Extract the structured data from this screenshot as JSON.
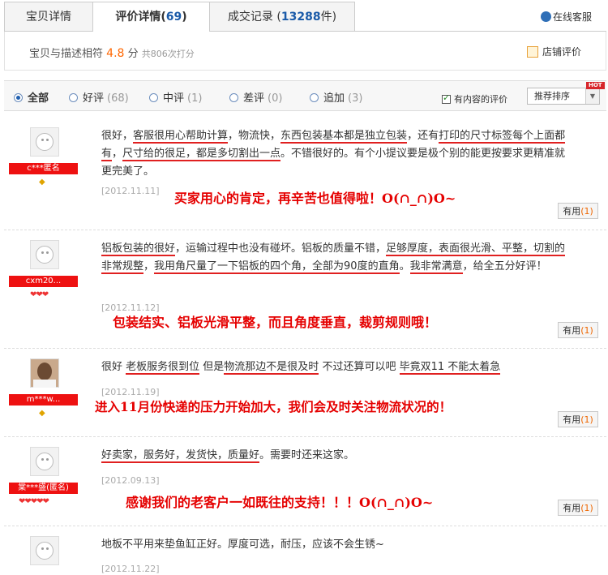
{
  "tabs": [
    {
      "label": "宝贝详情",
      "count": ""
    },
    {
      "label": "评价详情(",
      "count": "69",
      "suffix": ")"
    },
    {
      "label": "成交记录 (",
      "count": "13288",
      "suffix": "件)"
    }
  ],
  "online_service": "在线客服",
  "summary": {
    "label": "宝贝与描述相符",
    "score": "4.8",
    "unit": "分",
    "count_text": "共806次打分",
    "shop_rating": "店铺评价"
  },
  "filters": [
    {
      "label": "全部",
      "count": ""
    },
    {
      "label": "好评",
      "count": "(68)"
    },
    {
      "label": "中评",
      "count": "(1)"
    },
    {
      "label": "差评",
      "count": "(0)"
    },
    {
      "label": "追加",
      "count": "(3)"
    }
  ],
  "content_only_label": "有内容的评价",
  "sort": {
    "selected": "推荐排序",
    "hot": "HOT"
  },
  "reviews": [
    {
      "user": "c***匿名",
      "badge": "◆",
      "segments": [
        {
          "t": "很好，",
          "u": false
        },
        {
          "t": "客服很用心帮助计算",
          "u": true
        },
        {
          "t": "，物流快，",
          "u": false
        },
        {
          "t": "东西包装基本都是独立包装",
          "u": true
        },
        {
          "t": "，还有",
          "u": false
        },
        {
          "t": "打印的尺寸标签每个上面都有",
          "u": true
        },
        {
          "t": "，",
          "u": false
        },
        {
          "t": "尺寸给的很足，都是多切割出一点",
          "u": true
        },
        {
          "t": "。不错很好的。有个小提议要是极个别的能更按要求更精准就更完美了。",
          "u": false
        }
      ],
      "date": "[2012.11.11]",
      "annotation": "买家用心的肯定，再辛苦也值得啦！O(∩_∩)O~",
      "useful_label": "有用",
      "useful_count": "(1)"
    },
    {
      "user": "cxm20...",
      "badge": "❤❤❤",
      "segments": [
        {
          "t": "铝板包装的很好",
          "u": true
        },
        {
          "t": "，运输过程中也没有碰坏。铝板的质量不错，",
          "u": false
        },
        {
          "t": "足够厚度，表面很光滑、平整，切割的非常规整",
          "u": true
        },
        {
          "t": "，",
          "u": false
        },
        {
          "t": "我用角尺量了一下铝板的四个角，全部为90度的直角",
          "u": true
        },
        {
          "t": "。",
          "u": false
        },
        {
          "t": "我非常满意",
          "u": true
        },
        {
          "t": "，给全五分好评！",
          "u": false
        }
      ],
      "date": "[2012.11.12]",
      "annotation": "包装结实、铝板光滑平整，而且角度垂直，裁剪规则哦！",
      "useful_label": "有用",
      "useful_count": "(1)"
    },
    {
      "user": "m***w...",
      "badge": "◆",
      "segments": [
        {
          "t": "很好 ",
          "u": false
        },
        {
          "t": "老板服务很到位",
          "u": true
        },
        {
          "t": " 但是",
          "u": false
        },
        {
          "t": "物流那边不是很及时",
          "u": true
        },
        {
          "t": " 不过还算可以吧 ",
          "u": false
        },
        {
          "t": "毕竟双11 不能太着急",
          "u": true
        }
      ],
      "date": "[2012.11.19]",
      "annotation": "进入11月份快递的压力开始加大，我们会及时关注物流状况的！",
      "useful_label": "有用",
      "useful_count": "(1)"
    },
    {
      "user": "棠***盛(匿名)",
      "badge": "❤❤❤❤❤",
      "segments": [
        {
          "t": "好卖家，服务好，发货快，质量好",
          "u": true
        },
        {
          "t": "。需要时还来这家。",
          "u": false
        }
      ],
      "date": "[2012.09.13]",
      "annotation": "感谢我们的老客户一如既往的支持！！！O(∩_∩)O~",
      "useful_label": "有用",
      "useful_count": "(1)"
    },
    {
      "user": "",
      "badge": "",
      "segments": [
        {
          "t": "地板不平用来垫鱼缸正好。厚度可选，耐压，应该不会生锈~",
          "u": false
        }
      ],
      "date": "[2012.11.22]",
      "annotation": "",
      "useful_label": "",
      "useful_count": ""
    }
  ]
}
